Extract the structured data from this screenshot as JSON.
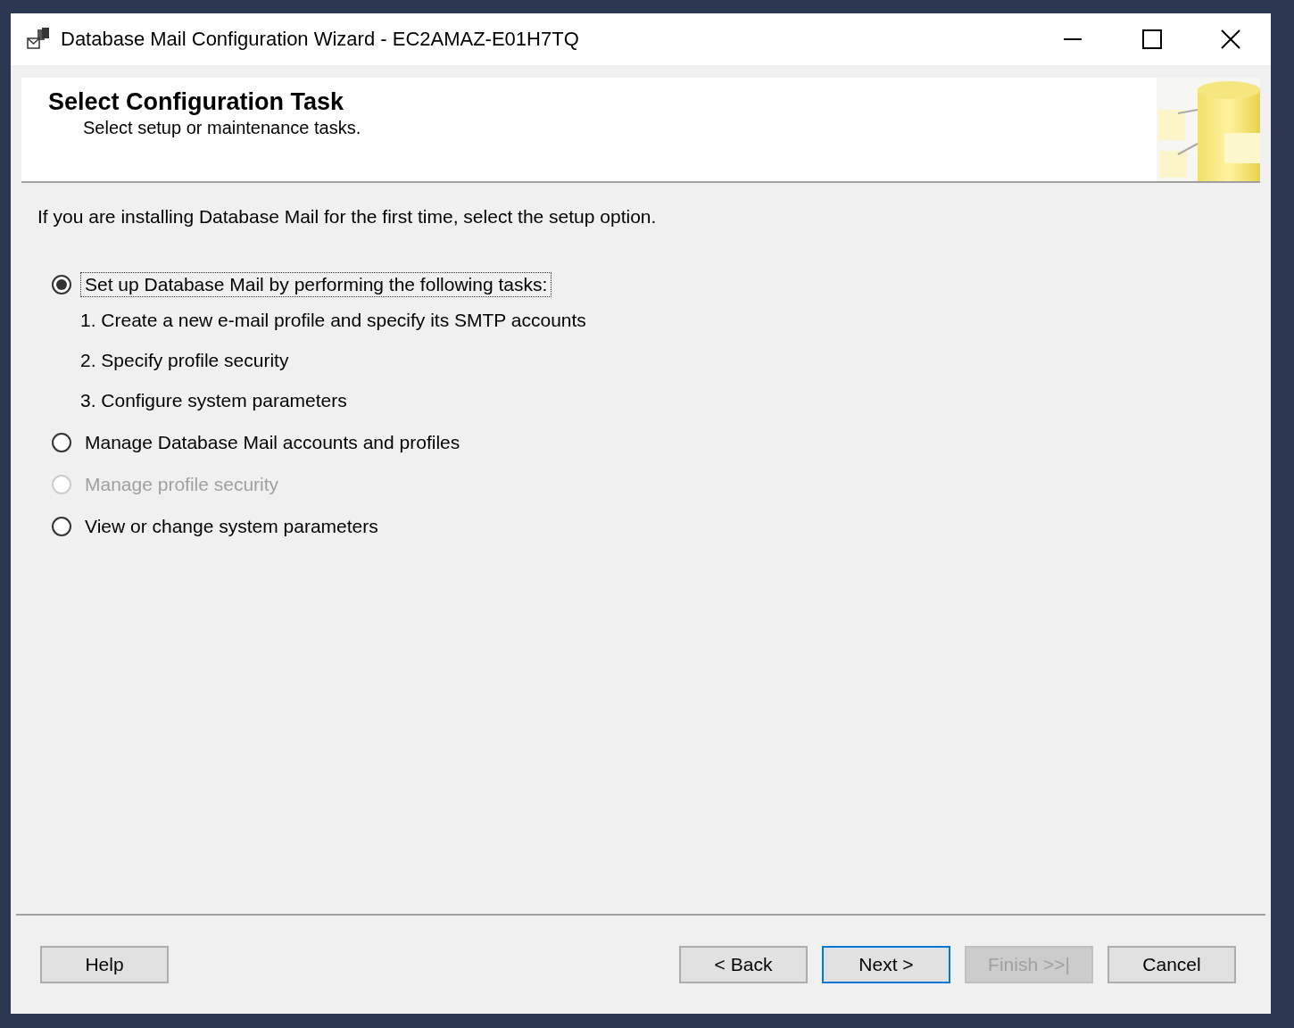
{
  "window": {
    "title": "Database Mail Configuration Wizard - EC2AMAZ-E01H7TQ"
  },
  "header": {
    "title": "Select Configuration Task",
    "subtitle": "Select setup or maintenance tasks."
  },
  "intro": "If you are installing Database Mail for the first time, select the setup option.",
  "options": [
    {
      "label": "Set up Database Mail by performing the following tasks:",
      "selected": true,
      "disabled": false,
      "focused": true,
      "tasks": [
        "1. Create a new e-mail profile and specify its SMTP accounts",
        "2. Specify profile security",
        "3. Configure system parameters"
      ]
    },
    {
      "label": "Manage Database Mail accounts and profiles",
      "selected": false,
      "disabled": false,
      "focused": false
    },
    {
      "label": "Manage profile security",
      "selected": false,
      "disabled": true,
      "focused": false
    },
    {
      "label": "View or change system parameters",
      "selected": false,
      "disabled": false,
      "focused": false
    }
  ],
  "buttons": [
    {
      "label": "Help",
      "disabled": false,
      "default": false,
      "kind": "left"
    },
    {
      "label": "< Back",
      "disabled": false,
      "default": false,
      "kind": "right"
    },
    {
      "label": "Next >",
      "disabled": false,
      "default": true,
      "kind": "right"
    },
    {
      "label": "Finish >>|",
      "disabled": true,
      "default": false,
      "kind": "right"
    },
    {
      "label": "Cancel",
      "disabled": false,
      "default": false,
      "kind": "right"
    }
  ]
}
